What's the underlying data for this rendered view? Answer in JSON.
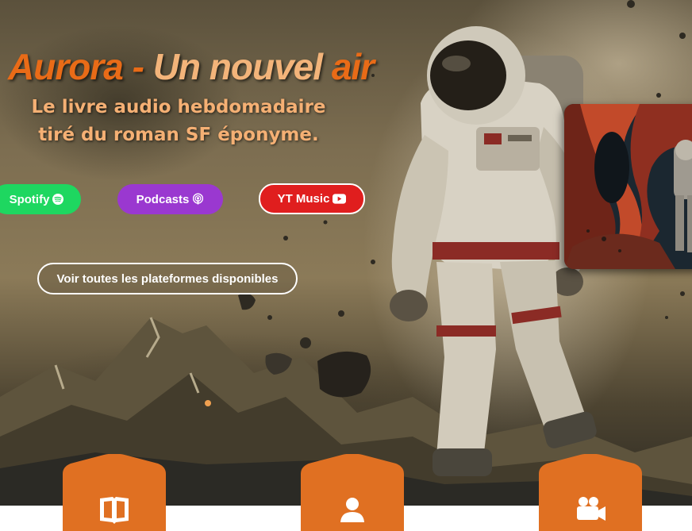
{
  "hero": {
    "title_part1": "Aurora - ",
    "title_part2": "Un nouvel ",
    "title_part3": "air",
    "subtitle_line1": "Le livre audio hebdomadaire",
    "subtitle_line2": "tiré du roman SF éponyme."
  },
  "platforms": [
    {
      "label": "Spotify",
      "icon": "spotify-icon",
      "color": "#1ed760"
    },
    {
      "label": "Podcasts",
      "icon": "podcasts-icon",
      "color": "#9a38d0"
    },
    {
      "label": "YT Music",
      "icon": "youtube-icon",
      "color": "#e01e1e"
    }
  ],
  "all_platforms_label": "Voir toutes les plateformes disponibles",
  "nav_tabs": [
    {
      "icon": "book-icon"
    },
    {
      "icon": "user-icon"
    },
    {
      "icon": "video-camera-icon"
    }
  ],
  "colors": {
    "title_orange": "#e96b17",
    "title_light": "#f3b47a",
    "tab_orange": "#e07022"
  }
}
